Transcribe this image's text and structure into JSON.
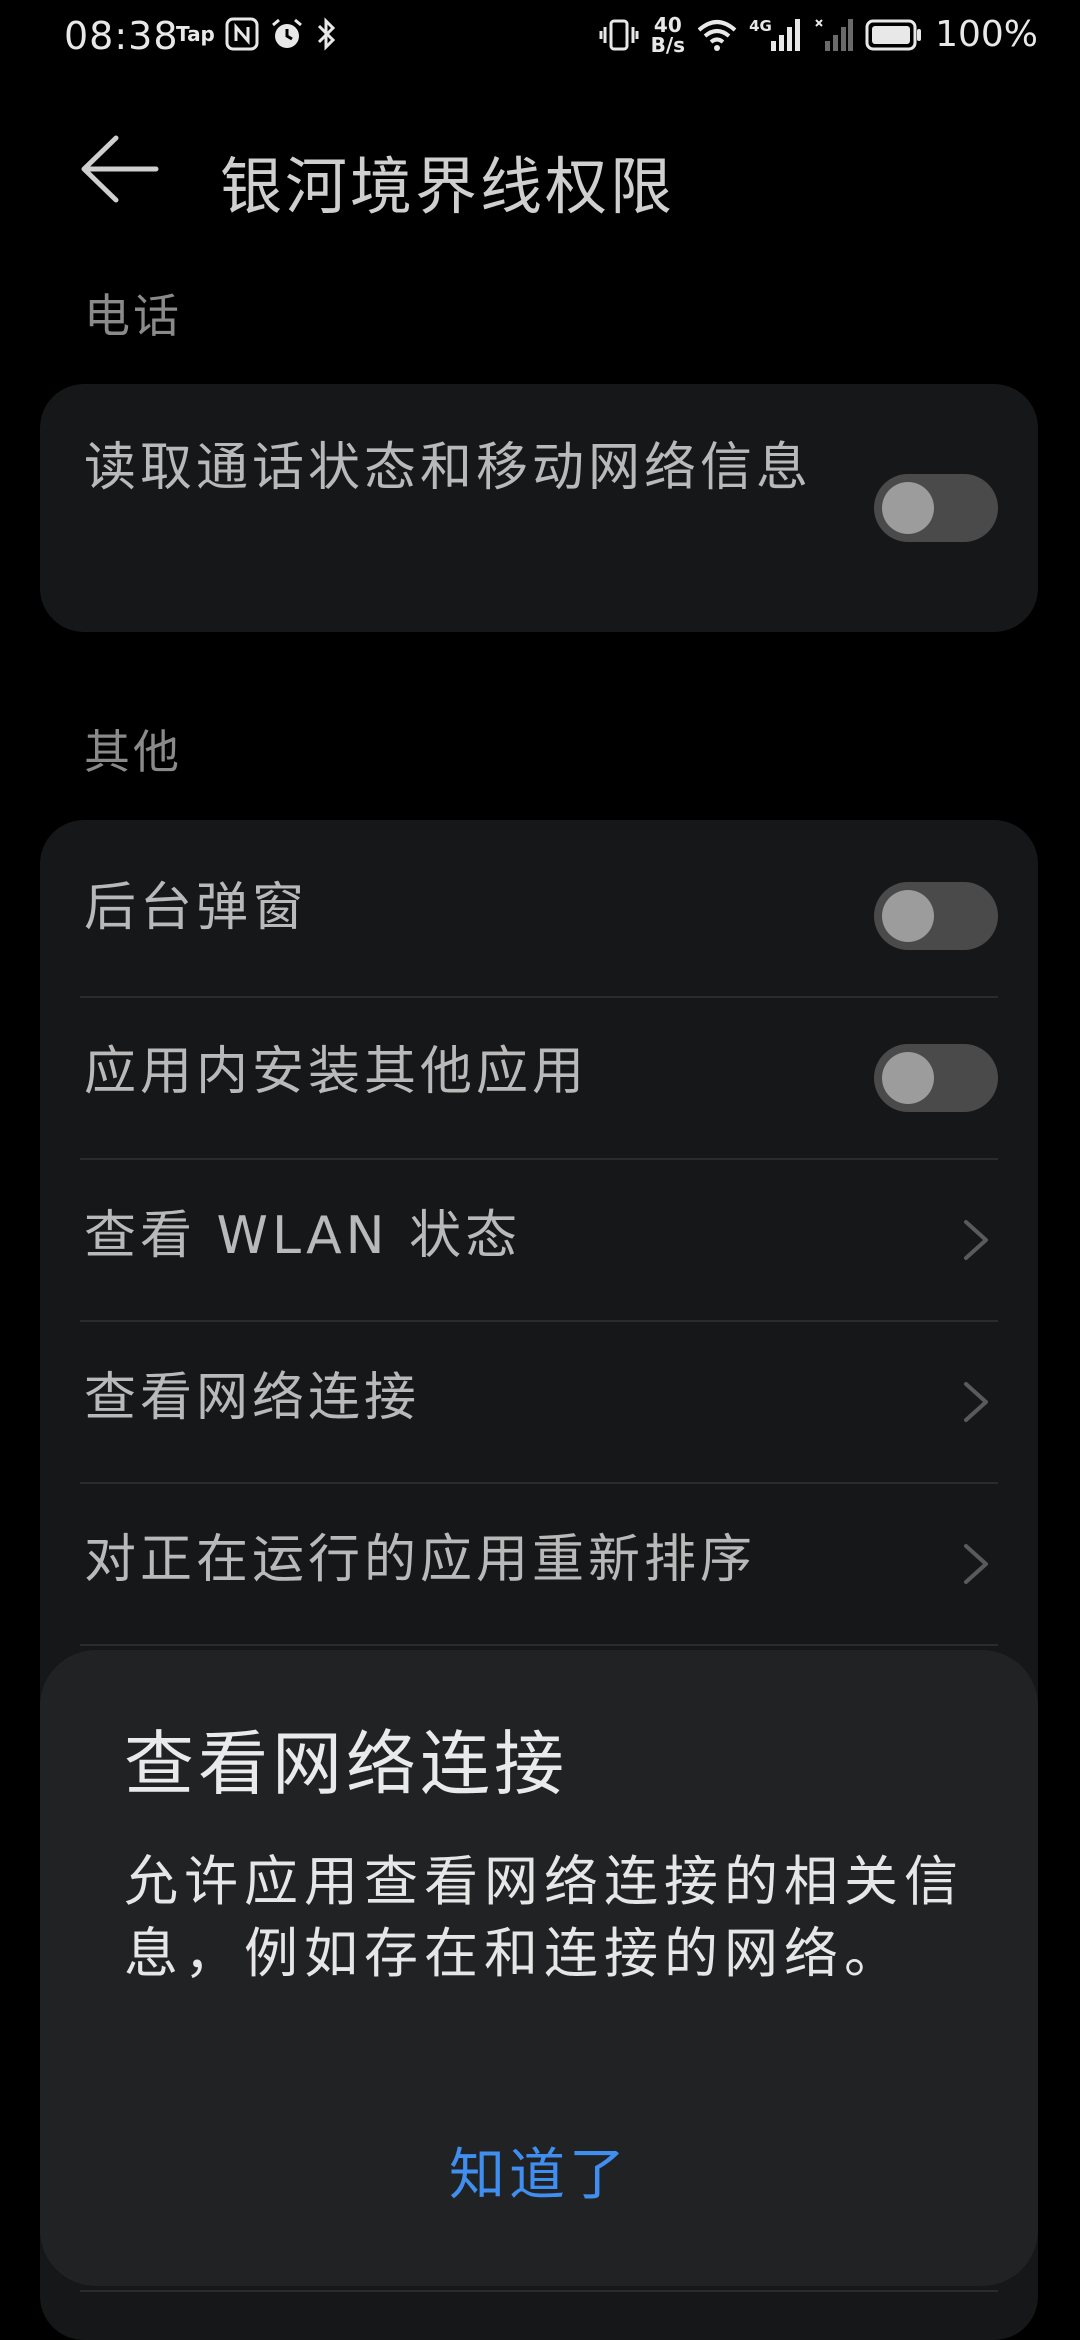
{
  "status_bar": {
    "time": "08:38",
    "left_icons": [
      "tap-icon",
      "nfc-icon",
      "alarm-icon",
      "bluetooth-icon"
    ],
    "network_speed_value": "40",
    "network_speed_unit": "B/s",
    "signal_label": "4G",
    "battery": "100%"
  },
  "header": {
    "title": "银河境界线权限"
  },
  "sections": {
    "phone": {
      "label": "电话",
      "items": [
        {
          "label": "读取通话状态和移动网络信息",
          "type": "toggle",
          "enabled": false
        }
      ]
    },
    "other": {
      "label": "其他",
      "items": [
        {
          "label": "后台弹窗",
          "type": "toggle",
          "enabled": false
        },
        {
          "label": "应用内安装其他应用",
          "type": "toggle",
          "enabled": false
        },
        {
          "label": "查看 WLAN 状态",
          "type": "link"
        },
        {
          "label": "查看网络连接",
          "type": "link"
        },
        {
          "label": "对正在运行的应用重新排序",
          "type": "link"
        }
      ]
    }
  },
  "dialog": {
    "title": "查看网络连接",
    "body": "允许应用查看网络连接的相关信息，例如存在和连接的网络。",
    "button": "知道了"
  },
  "colors": {
    "background": "#000000",
    "card": "#161718",
    "dialog": "#212224",
    "accent": "#3f8ef0",
    "toggle_off_track": "#4a4a4b",
    "toggle_off_knob": "#9c9c9c"
  }
}
